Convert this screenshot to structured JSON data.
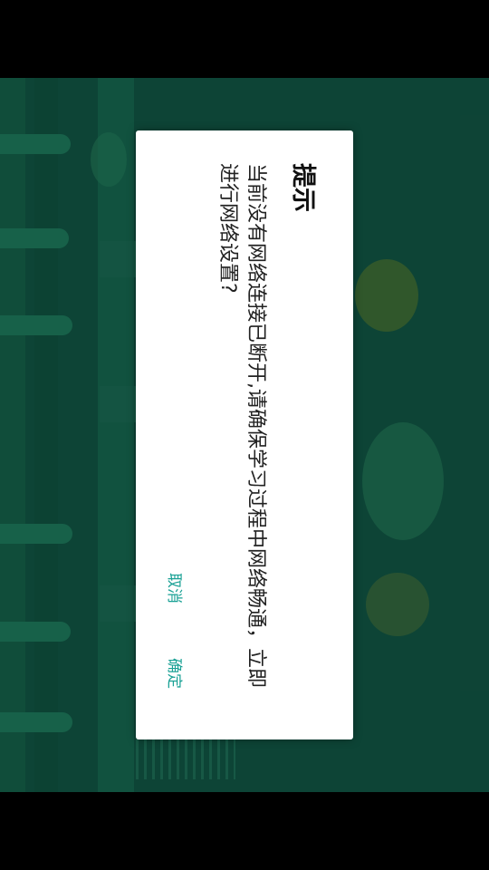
{
  "dialog": {
    "title": "提示",
    "message": "当前没有网络连接已断开,请确保学习过程中网络畅通，立即进行网络设置?",
    "cancel_label": "取消",
    "confirm_label": "确定"
  },
  "colors": {
    "accent": "#1aa195",
    "background": "#0f4a3b",
    "dialog": "#ffffff"
  }
}
